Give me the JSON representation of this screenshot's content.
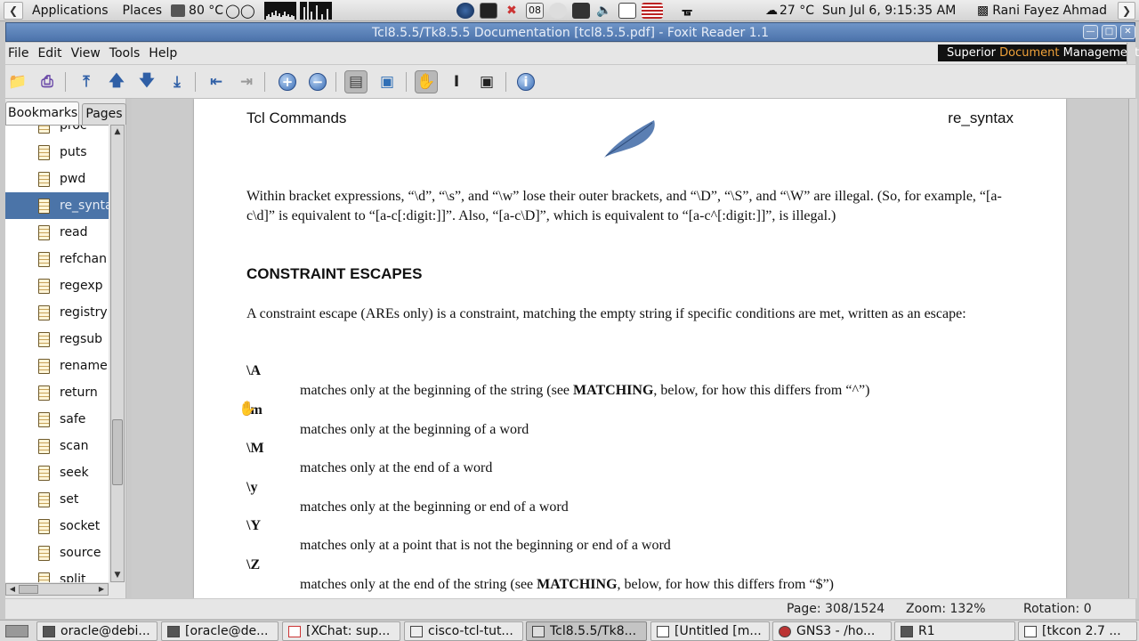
{
  "top_panel": {
    "applications_label": "Applications",
    "places_label": "Places",
    "temperature_cpu": "80 °C",
    "weather": "27 °C",
    "clock": "Sun Jul  6,  9:15:35 AM",
    "user": "Rani Fayez Ahmad",
    "date_badge": "08"
  },
  "window": {
    "title": "Tcl8.5.5/Tk8.5.5 Documentation [tcl8.5.5.pdf] - Foxit Reader 1.1"
  },
  "menu": {
    "file": "File",
    "edit": "Edit",
    "view": "View",
    "tools": "Tools",
    "help": "Help",
    "brand_prefix": "Superior ",
    "brand_accent": "Document",
    "brand_suffix": " Management"
  },
  "sidebar": {
    "tab_bookmarks": "Bookmarks",
    "tab_pages": "Pages",
    "items": [
      "proc",
      "puts",
      "pwd",
      "re_syntax",
      "read",
      "refchan",
      "regexp",
      "registry",
      "regsub",
      "rename",
      "return",
      "safe",
      "scan",
      "seek",
      "set",
      "socket",
      "source",
      "split"
    ],
    "selected": "re_syntax"
  },
  "document": {
    "header_left": "Tcl Commands",
    "header_right": "re_syntax",
    "intro": "Within bracket expressions, “\\d”, “\\s”, and “\\w” lose their outer brackets, and “\\D”, “\\S”, and “\\W” are illegal. (So, for example, “[a-c\\d]” is equivalent to “[a-c[:digit:]]”. Also, “[a-c\\D]”, which is equivalent to “[a-c^[:digit:]]”, is illegal.)",
    "section_title": "CONSTRAINT ESCAPES",
    "section_intro": "A constraint escape (AREs only) is a constraint, matching the empty string if specific conditions are met, written as an escape:",
    "escapes": [
      {
        "term": "\\A",
        "desc_before": "matches only at the beginning of the string (see ",
        "desc_bold": "MATCHING",
        "desc_after": ", below, for how this differs from “^”)"
      },
      {
        "term": "\\m",
        "desc_before": "matches only at the beginning of a word",
        "desc_bold": "",
        "desc_after": ""
      },
      {
        "term": "\\M",
        "desc_before": "matches only at the end of a word",
        "desc_bold": "",
        "desc_after": ""
      },
      {
        "term": "\\y",
        "desc_before": "matches only at the beginning or end of a word",
        "desc_bold": "",
        "desc_after": ""
      },
      {
        "term": "\\Y",
        "desc_before": "matches only at a point that is not the beginning or end of a word",
        "desc_bold": "",
        "desc_after": ""
      },
      {
        "term": "\\Z",
        "desc_before": "matches only at the end of the string (see ",
        "desc_bold": "MATCHING",
        "desc_after": ", below, for how this differs from “$”)"
      }
    ]
  },
  "status": {
    "page": "Page: 308/1524",
    "zoom": "Zoom: 132%",
    "rotation": "Rotation: 0"
  },
  "taskbar": {
    "tasks": [
      "oracle@debi...",
      "[oracle@de...",
      "[XChat: sup...",
      "cisco-tcl-tut...",
      "Tcl8.5.5/Tk8...",
      "[Untitled [m...",
      "GNS3 - /ho...",
      "R1",
      "[tkcon 2.7 ..."
    ],
    "active_index": 4
  }
}
